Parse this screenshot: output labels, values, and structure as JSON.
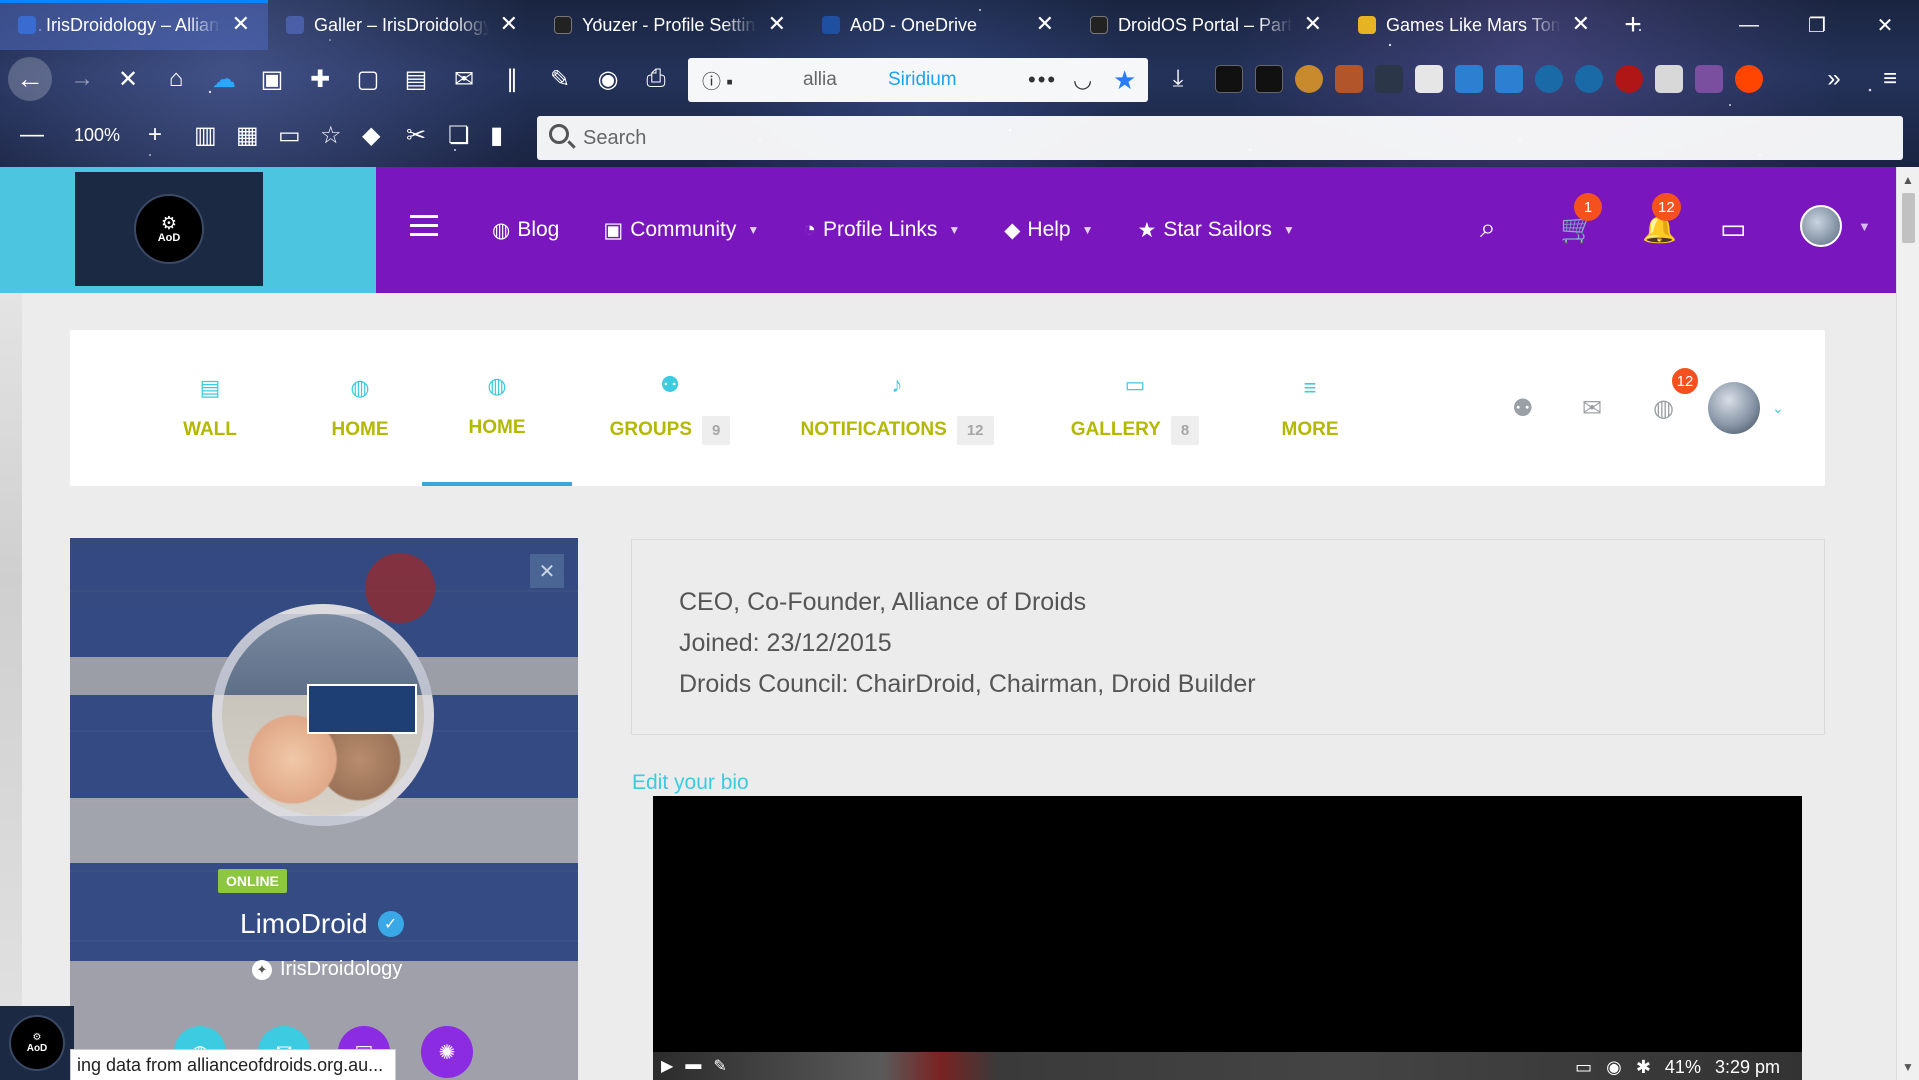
{
  "browser": {
    "tabs": [
      {
        "title": "IrisDroidology – Allian",
        "active": true,
        "favicon_color": "#3a6bd1"
      },
      {
        "title": "Galler – IrisDroidology",
        "active": false,
        "favicon_color": "#4a5fa8"
      },
      {
        "title": "Youzer - Profile Settin",
        "active": false,
        "favicon_color": "#222222"
      },
      {
        "title": "AoD - OneDrive",
        "active": false,
        "favicon_color": "#1f4fa0"
      },
      {
        "title": "DroidOS Portal – Part",
        "active": false,
        "favicon_color": "#222222"
      },
      {
        "title": "Games Like Mars Tom",
        "active": false,
        "favicon_color": "#e6b422"
      }
    ],
    "new_tab_label": "+",
    "url_text": "allia",
    "url_site_label": "Siridium",
    "zoom": "100%",
    "search_placeholder": "Search"
  },
  "site": {
    "nav": [
      {
        "label": "Blog",
        "icon": "globe-icon",
        "dropdown": false
      },
      {
        "label": "Community",
        "icon": "image-icon",
        "dropdown": true
      },
      {
        "label": "Profile Links",
        "icon": "rss-icon",
        "dropdown": true
      },
      {
        "label": "Help",
        "icon": "graduation-cap-icon",
        "dropdown": true
      },
      {
        "label": "Star Sailors",
        "icon": "star-icon",
        "dropdown": true
      }
    ],
    "cart_badge": "1",
    "notifications_badge": "12",
    "accent": "#7a16bd",
    "logo_text": "AoD"
  },
  "profile_tabs": {
    "tabs": [
      {
        "label": "WALL",
        "count": null
      },
      {
        "label": "HOME",
        "count": null
      },
      {
        "label": "HOME",
        "count": null,
        "active": true
      },
      {
        "label": "GROUPS",
        "count": "9"
      },
      {
        "label": "NOTIFICATIONS",
        "count": "12"
      },
      {
        "label": "GALLERY",
        "count": "8"
      },
      {
        "label": "MORE",
        "count": null
      }
    ],
    "notif_badge": "12"
  },
  "profile": {
    "status": "ONLINE",
    "name": "LimoDroid",
    "subtitle": "IrisDroidology"
  },
  "bio": {
    "lines": [
      "CEO, Co-Founder, Alliance of Droids",
      "Joined: 23/12/2015",
      "Droids Council: ChairDroid, Chairman, Droid Builder"
    ],
    "edit_link": "Edit your bio"
  },
  "video": {
    "battery": "41%",
    "time": "3:29 pm"
  },
  "status_bar": {
    "text": "ing data from allianceofdroids.org.au..."
  }
}
